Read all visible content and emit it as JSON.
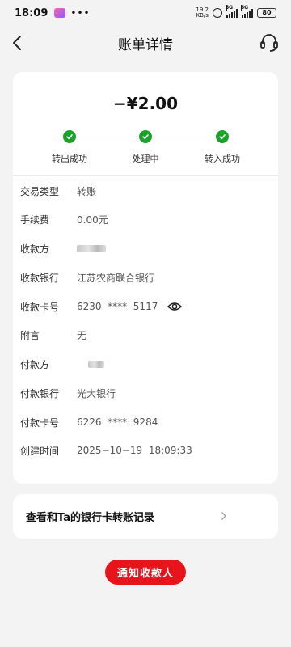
{
  "status_bar": {
    "time": "18:09",
    "net_speed_value": "19.2",
    "net_speed_unit": "KB/s",
    "signal_label_1": "5G",
    "signal_label_2": "5G",
    "battery": "80"
  },
  "header": {
    "title": "账单详情",
    "back_icon": "chevron-left-icon",
    "service_icon": "headset-icon"
  },
  "transaction": {
    "amount": "−¥2.00",
    "steps": [
      {
        "label": "转出成功"
      },
      {
        "label": "处理中"
      },
      {
        "label": "转入成功"
      }
    ],
    "details": [
      {
        "label": "交易类型",
        "value": "转账"
      },
      {
        "label": "手续费",
        "value": "0.00元"
      },
      {
        "label": "收款方",
        "value": ""
      },
      {
        "label": "收款银行",
        "value": "江苏农商联合银行"
      },
      {
        "label": "收款卡号",
        "value": "6230  ****  5117"
      },
      {
        "label": "附言",
        "value": "无"
      },
      {
        "label": "付款方",
        "value": ""
      },
      {
        "label": "付款银行",
        "value": "光大银行"
      },
      {
        "label": "付款卡号",
        "value": "6226  ****  9284"
      },
      {
        "label": "创建时间",
        "value": "2025−10−19  18:09:33"
      }
    ]
  },
  "records_link": {
    "label": "查看和Ta的银行卡转账记录"
  },
  "notify_button": {
    "label": "通知收款人"
  },
  "colors": {
    "success": "#1aa32b",
    "primary_red": "#e8141b"
  }
}
